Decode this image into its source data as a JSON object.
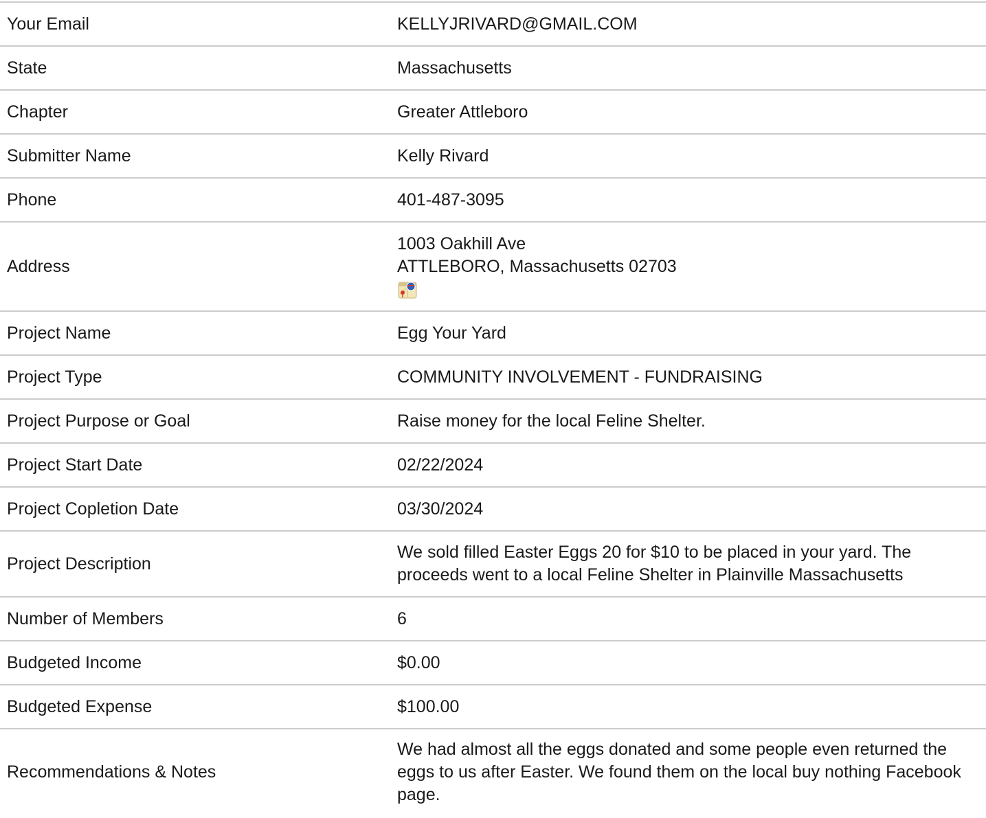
{
  "rows": [
    {
      "label": "Your Email",
      "value": "KELLYJRIVARD@GMAIL.COM"
    },
    {
      "label": "State",
      "value": "Massachusetts"
    },
    {
      "label": "Chapter",
      "value": "Greater Attleboro"
    },
    {
      "label": "Submitter Name",
      "value": "Kelly Rivard"
    },
    {
      "label": "Phone",
      "value": "401-487-3095"
    },
    {
      "label": "Address",
      "value_line1": "1003 Oakhill Ave",
      "value_line2": "ATTLEBORO, Massachusetts 02703",
      "icon": "map-icon"
    },
    {
      "label": "Project Name",
      "value": "Egg Your Yard"
    },
    {
      "label": "Project Type",
      "value": "COMMUNITY INVOLVEMENT - FUNDRAISING"
    },
    {
      "label": "Project Purpose or Goal",
      "value": "Raise money for the local Feline Shelter."
    },
    {
      "label": "Project Start Date",
      "value": "02/22/2024"
    },
    {
      "label": "Project Copletion Date",
      "value": "03/30/2024"
    },
    {
      "label": "Project Description",
      "value": "We sold filled Easter Eggs 20 for $10 to be placed in your yard. The proceeds went to a local Feline Shelter in Plainville Massachusetts"
    },
    {
      "label": "Number of Members",
      "value": "6"
    },
    {
      "label": "Budgeted Income",
      "value": "$0.00"
    },
    {
      "label": "Budgeted Expense",
      "value": "$100.00"
    },
    {
      "label": "Recommendations & Notes",
      "value": "We had almost all the eggs donated and some people even returned the eggs to us after Easter. We found them on the local buy nothing Facebook page."
    }
  ],
  "colors": {
    "divider": "#cccccc",
    "text": "#1a1a1a"
  }
}
